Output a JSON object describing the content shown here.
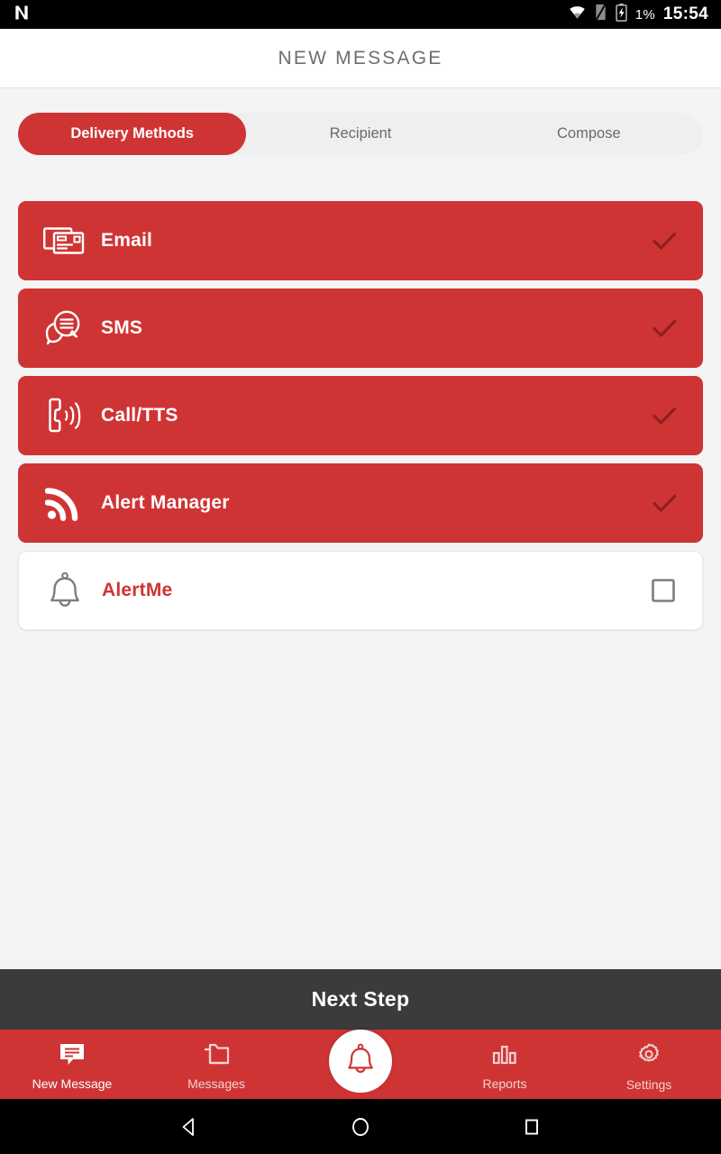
{
  "status_bar": {
    "app_icon": "nova-launcher-icon",
    "wifi_icon": "wifi-icon",
    "signal_icon": "no-sim-signal-icon",
    "battery_icon": "battery-charging-icon",
    "battery_percent": "1%",
    "time": "15:54"
  },
  "header": {
    "title": "NEW MESSAGE"
  },
  "tabs": {
    "items": [
      {
        "label": "Delivery Methods",
        "active": true
      },
      {
        "label": "Recipient",
        "active": false
      },
      {
        "label": "Compose",
        "active": false
      }
    ]
  },
  "delivery_methods": {
    "items": [
      {
        "label": "Email",
        "icon": "email-envelopes-icon",
        "selected": true,
        "state_icon": "check-icon"
      },
      {
        "label": "SMS",
        "icon": "chat-bubbles-icon",
        "selected": true,
        "state_icon": "check-icon"
      },
      {
        "label": "Call/TTS",
        "icon": "phone-waves-icon",
        "selected": true,
        "state_icon": "check-icon"
      },
      {
        "label": "Alert Manager",
        "icon": "broadcast-rss-icon",
        "selected": true,
        "state_icon": "check-icon"
      },
      {
        "label": "AlertMe",
        "icon": "bell-outline-icon",
        "selected": false,
        "state_icon": "empty-checkbox-icon"
      }
    ]
  },
  "next_step": {
    "label": "Next Step"
  },
  "bottom_nav": {
    "items": [
      {
        "label": "New Message",
        "icon": "chat-filled-icon",
        "active": true
      },
      {
        "label": "Messages",
        "icon": "folders-icon",
        "active": false
      },
      {
        "label": "Reports",
        "icon": "bar-chart-icon",
        "active": false
      },
      {
        "label": "Settings",
        "icon": "gear-icon",
        "active": false
      }
    ],
    "fab": {
      "icon": "bell-outline-icon"
    }
  },
  "android_nav": {
    "back": "back-triangle-icon",
    "home": "home-circle-icon",
    "recents": "recents-square-icon"
  },
  "colors": {
    "brand_red": "#cf3434",
    "dark_bar": "#3b3b3b",
    "page_bg": "#f4f4f4",
    "check_dark": "#8e1f1f"
  }
}
